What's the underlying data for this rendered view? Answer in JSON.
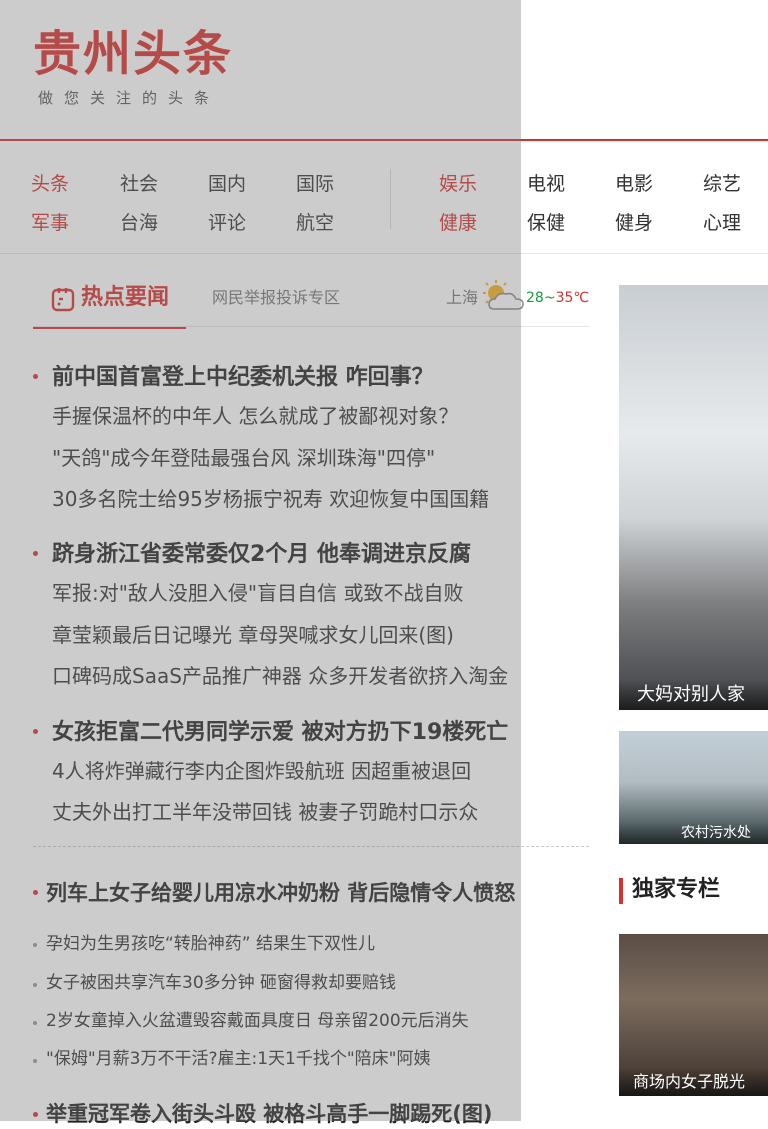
{
  "header": {
    "logo_title": "贵州头条",
    "logo_tagline": "做您关注的头条"
  },
  "nav": {
    "row1": [
      "头条",
      "社会",
      "国内",
      "国际",
      "娱乐",
      "电视",
      "电影",
      "综艺"
    ],
    "row2": [
      "军事",
      "台海",
      "评论",
      "航空",
      "健康",
      "保健",
      "健身",
      "心理"
    ],
    "accent_color": "#d9302a"
  },
  "hot": {
    "tab_label": "热点要闻",
    "report_link": "网民举报投诉专区",
    "weather": {
      "city": "上海",
      "low": "28",
      "sep": "~",
      "high": "35℃"
    }
  },
  "news": [
    {
      "headline": "前中国首富登上中纪委机关报 咋回事？",
      "subs": [
        "手握保温杯的中年人 怎么就成了被鄙视对象？",
        "\"天鸽\"成今年登陆最强台风 深圳珠海\"四停\"",
        "30多名院士给95岁杨振宁祝寿 欢迎恢复中国国籍"
      ]
    },
    {
      "headline": "跻身浙江省委常委仅2个月 他奉调进京反腐",
      "subs": [
        "军报:对\"敌人没胆入侵\"盲目自信 或致不战自败",
        "章莹颖最后日记曝光 章母哭喊求女儿回来(图)",
        "口碑码成SaaS产品推广神器 众多开发者欲挤入淘金"
      ]
    },
    {
      "headline": "女孩拒富二代男同学示爱 被对方扔下19楼死亡",
      "subs": [
        "4人将炸弹藏行李内企图炸毁航班 因超重被退回",
        "丈夫外出打工半年没带回钱 被妻子罚跪村口示众"
      ]
    }
  ],
  "news2": {
    "headline": "列车上女子给婴儿用凉水冲奶粉 背后隐情令人愤怒",
    "items": [
      "孕妇为生男孩吃“转胎神药” 结果生下双性儿",
      "女子被困共享汽车30多分钟 砸窗得救却要赔钱",
      "2岁女童掉入火盆遭毁容戴面具度日 母亲留200元后消失",
      "\"保姆\"月薪3万不干活?雇主:1天1千找个\"陪床\"阿姨"
    ],
    "bottom_headline": "举重冠军卷入街头斗殴 被格斗高手一脚踢死(图)"
  },
  "right": {
    "photo1_caption": "大妈对别人家",
    "photo2_caption": "农村污水处",
    "exclusive_title": "独家专栏",
    "photo3_caption": "商场内女子脱光"
  }
}
